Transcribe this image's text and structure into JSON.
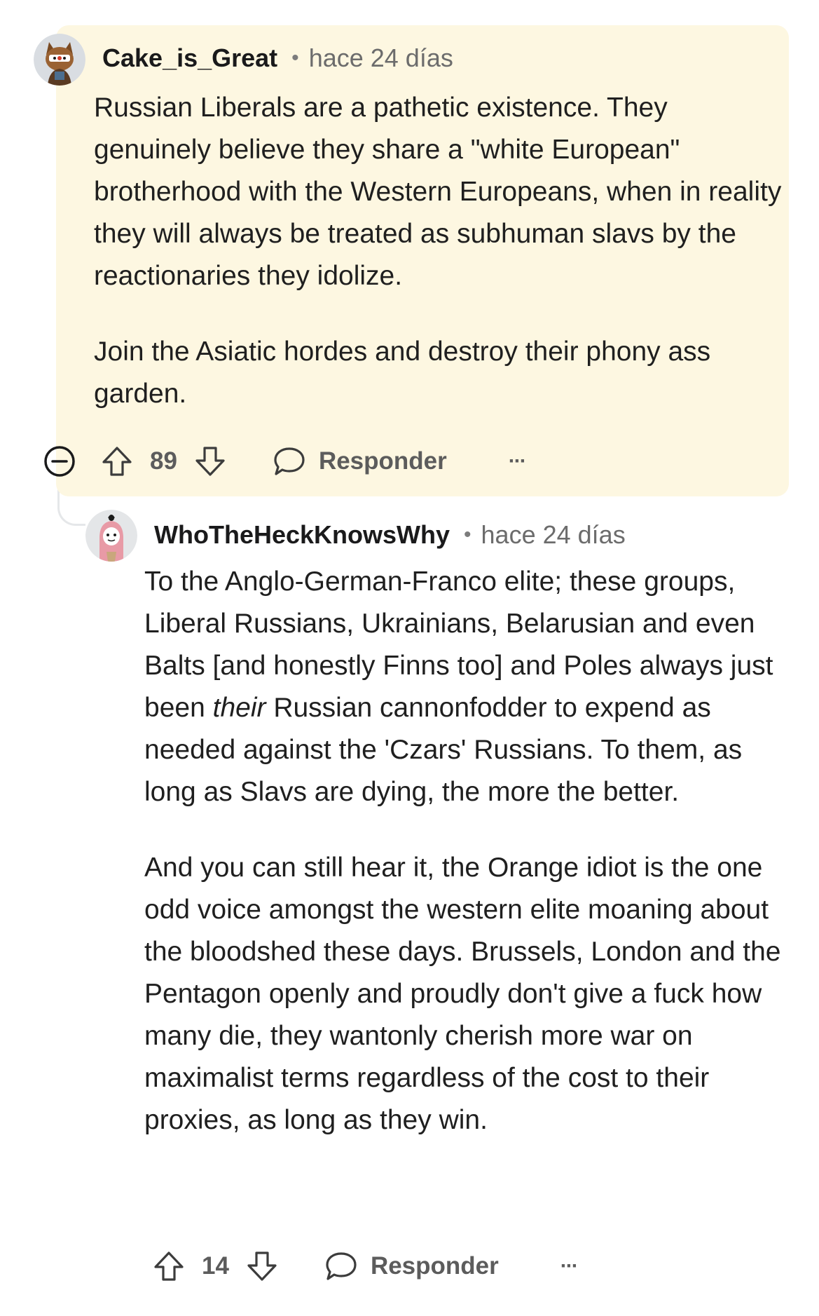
{
  "comments": [
    {
      "username": "Cake_is_Great",
      "separator": "•",
      "time": "hace 24 días",
      "paragraphs": [
        "Russian Liberals are a pathetic existence. They genuinely believe they share a \"white European\" brotherhood with the Western Europeans, when in reality they will always be treated as subhuman slavs by the reactionaries they idolize.",
        "Join the Asiatic hordes and destroy their phony ass garden."
      ],
      "votes": "89",
      "reply_label": "Responder",
      "more_label": "···"
    },
    {
      "username": "WhoTheHeckKnowsWhy",
      "separator": "•",
      "time": "hace 24 días",
      "paragraph1_a": "To the Anglo-German-Franco elite; these groups, Liberal Russians, Ukrainians, Belarusian and even Balts [and honestly Finns too] and Poles always just been ",
      "paragraph1_em": "their",
      "paragraph1_b": " Russian cannonfodder to expend as needed against the 'Czars' Russians. To them, as long as Slavs are dying, the more the better.",
      "paragraph2": "And you can still hear it, the Orange idiot is the one odd voice amongst the western elite moaning about the bloodshed these days. Brussels, London and the Pentagon openly and proudly don't give a fuck how many die, they wantonly cherish more war on maximalist terms regardless of the cost to their proxies, as long as they win.",
      "votes": "14",
      "reply_label": "Responder",
      "more_label": "···"
    }
  ],
  "colors": {
    "highlight": "#fdf7e1",
    "thread_line": "#e5e7e9",
    "meta_text": "#6c6c6c"
  }
}
